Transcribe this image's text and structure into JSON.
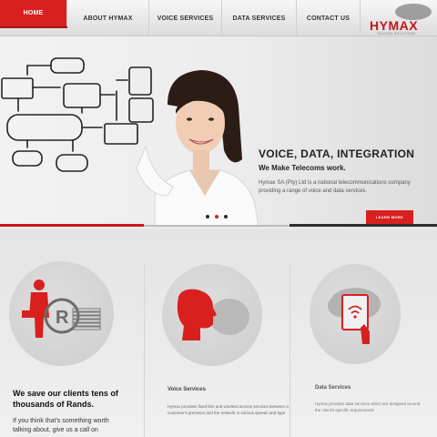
{
  "nav": {
    "items": [
      {
        "label": "HOME"
      },
      {
        "label": "ABOUT HYMAX"
      },
      {
        "label": "VOICE SERVICES"
      },
      {
        "label": "DATA SERVICES"
      },
      {
        "label": "CONTACT US"
      }
    ]
  },
  "logo": {
    "name": "HYMAX",
    "tagline": "TALKING SOLUTIONS"
  },
  "hero": {
    "headline": "VOICE, DATA, INTEGRATION",
    "subheadline": "We Make Telecoms work.",
    "body": "Hymax SA (Pty) Ltd is a national telecommunications company providing a range of voice and data services.",
    "button": "LEARN MORE",
    "slides": 3,
    "active_slide": 2
  },
  "features": [
    {
      "title": "We save our clients tens of thousands of Rands.",
      "body": "If you think that's something worth talking about, give us a call on"
    },
    {
      "title": "Voice Services",
      "body": "Hymax provides fixed-line and wireless access services between a customer's premises and the network in various speeds and type"
    },
    {
      "title": "Data Services",
      "body": "Hymax provides data services which are designed around the client's specific requirements"
    }
  ],
  "colors": {
    "accent": "#d8201f",
    "dark": "#2f2f2f"
  }
}
